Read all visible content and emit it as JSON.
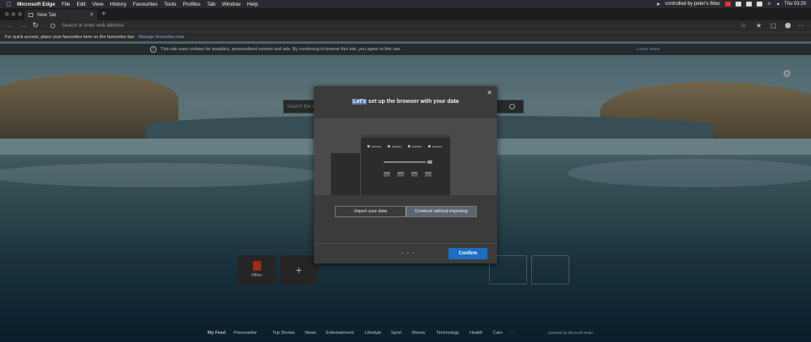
{
  "menubar": {
    "app": "Microsoft Edge",
    "items": [
      "File",
      "Edit",
      "View",
      "History",
      "Favourites",
      "Tools",
      "Profiles",
      "Tab",
      "Window",
      "Help"
    ],
    "status": "controlled by peter's iMac",
    "clock": "Thu 03:20"
  },
  "tabs": [
    {
      "label": "New Tab"
    }
  ],
  "toolbar": {
    "omnibox_placeholder": "Search or enter web address"
  },
  "favbar": {
    "text": "For quick access, place your favourites here on the favourites bar.",
    "link": "Manage favourites now"
  },
  "cookie": {
    "message": "This site uses cookies for analytics, personalized content and ads. By continuing to browse this site, you agree to this use.",
    "link": "Learn more"
  },
  "search": {
    "placeholder": "Search the w"
  },
  "tiles": [
    {
      "label": "Office"
    }
  ],
  "feednav": {
    "items": [
      "My Feed",
      "Personalise",
      "Top Stories",
      "News",
      "Entertainment",
      "Lifestyle",
      "Sport",
      "Money",
      "Technology",
      "Health",
      "Cars",
      "···"
    ],
    "powered": "powered by Microsoft News"
  },
  "dialog": {
    "title_highlight": "Let's",
    "title_rest": " set up the browser with your data",
    "option_import": "Import your data",
    "option_continue": "Continue without importing",
    "confirm": "Confirm",
    "pager": "• • •"
  },
  "colors": {
    "accent": "#1b6ec2",
    "link": "#7aa8e0"
  }
}
